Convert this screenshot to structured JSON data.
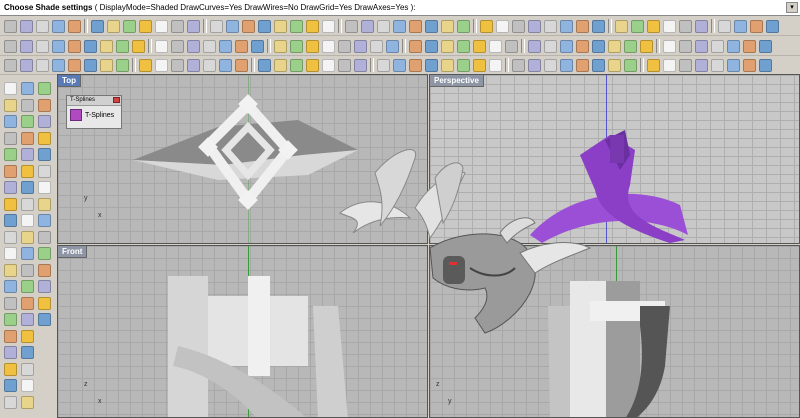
{
  "command": {
    "prompt": "Choose Shade settings",
    "options": "( DisplayMode=Shaded  DrawCurves=Yes  DrawWires=No  DrawGrid=Yes  DrawAxes=Yes ):"
  },
  "viewports": {
    "top": {
      "label": "Top"
    },
    "perspective": {
      "label": "Perspective"
    },
    "front": {
      "label": "Front"
    },
    "right": {
      "label": ""
    }
  },
  "axes": {
    "y": "y",
    "x": "x"
  },
  "tsplines_panel": {
    "title": "T-Splines",
    "button_label": "T-Splines"
  },
  "colors": {
    "ui_bg": "#d4d0c8",
    "viewport_bg": "#b8b8b8",
    "active_label": "#5a7ab6",
    "tsplines_purple": "#9b4fd6",
    "axis_x": "#a03030",
    "axis_y": "#3a9a3a"
  },
  "icons": {
    "toolbar": "rhino-command-icons",
    "left": "rhino-tool-palette-icons"
  }
}
